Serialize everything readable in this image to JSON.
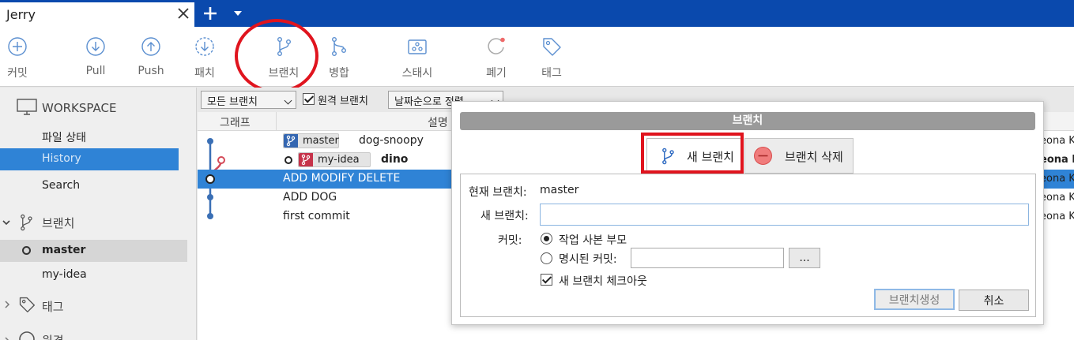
{
  "tab": {
    "title": "Jerry"
  },
  "toolbar": {
    "items": [
      {
        "label": "커밋"
      },
      {
        "label": "Pull"
      },
      {
        "label": "Push"
      },
      {
        "label": "패치"
      },
      {
        "label": "브랜치"
      },
      {
        "label": "병합"
      },
      {
        "label": "스태시"
      },
      {
        "label": "폐기"
      },
      {
        "label": "태그"
      }
    ]
  },
  "sidebar": {
    "workspace": "WORKSPACE",
    "workspace_items": [
      {
        "label": "파일 상태"
      },
      {
        "label": "History"
      },
      {
        "label": "Search"
      }
    ],
    "branches_title": "브랜치",
    "branches": [
      {
        "label": "master"
      },
      {
        "label": "my-idea"
      }
    ],
    "tags_title": "태그",
    "remotes_title": "원격"
  },
  "filters": {
    "branch_filter": "모든 브랜치",
    "remote_branches": "원격 브랜치",
    "sort": "날짜순으로 정렬"
  },
  "columns": {
    "graph": "그래프",
    "description": "설명"
  },
  "commits": [
    {
      "badge": "master",
      "message": "dog-snoopy",
      "author": "eona K"
    },
    {
      "badge": "my-idea",
      "message": "dino",
      "author": "eona K"
    },
    {
      "message": "ADD MODIFY DELETE",
      "author": "eona K"
    },
    {
      "message": "ADD DOG",
      "author": "eona K"
    },
    {
      "message": "first commit",
      "author": "eona K"
    }
  ],
  "colors": {
    "accent": "#0a49ad",
    "selection": "#2f83d6",
    "highlight": "#e0141e"
  },
  "dialog": {
    "title": "브랜치",
    "tab_new": "새 브랜치",
    "tab_delete": "브랜치 삭제",
    "current_branch_label": "현재 브랜치:",
    "current_branch_value": "master",
    "new_branch_label": "새 브랜치:",
    "new_branch_value": "",
    "commit_label": "커밋:",
    "option_working_parent": "작업 사본 부모",
    "option_specified_commit": "명시된 커밋:",
    "specified_commit_value": "",
    "browse_label": "...",
    "checkout_label": "새 브랜치 체크아웃",
    "create_button": "브랜치생성",
    "cancel_button": "취소"
  }
}
